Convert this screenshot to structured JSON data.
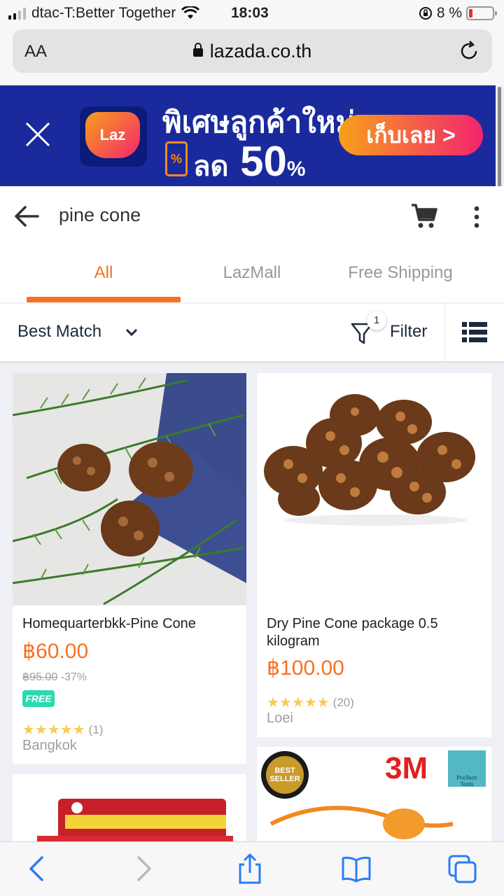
{
  "status": {
    "carrier": "dtac-T:Better Together",
    "time": "18:03",
    "battery": "8 %"
  },
  "browser": {
    "text_size": "AA",
    "domain": "lazada.co.th"
  },
  "banner": {
    "logo": "Laz",
    "headline": "พิเศษลูกค้าใหม่",
    "discount_prefix": "ลด",
    "discount_value": "50",
    "discount_unit": "%",
    "coupon_symbol": "%",
    "cta": "เก็บเลย >"
  },
  "search": {
    "query": "pine cone"
  },
  "tabs": [
    {
      "label": "All",
      "active": true
    },
    {
      "label": "LazMall",
      "active": false
    },
    {
      "label": "Free Shipping",
      "active": false
    }
  ],
  "sort": {
    "label": "Best Match",
    "filter_label": "Filter",
    "filter_count": "1"
  },
  "products": [
    {
      "title": "Homequarterbkk-Pine Cone",
      "price": "฿60.00",
      "original_price": "฿95.00",
      "discount": "-37%",
      "free_badge": "FREE",
      "rating": 5,
      "reviews": "(1)",
      "location": "Bangkok"
    },
    {
      "title": "Dry Pine Cone package 0.5 kilogram",
      "price": "฿100.00",
      "rating": 5,
      "reviews": "(20)",
      "location": "Loei"
    },
    {
      "title": ""
    },
    {
      "brand_logo": "3M",
      "seller_badge": "BEST SELLER",
      "store_logo": "ProTech Tools"
    }
  ],
  "colors": {
    "accent": "#f57224",
    "banner_bg": "#1a2a9c",
    "free_badge": "#2bd9b1",
    "star": "#faca51"
  }
}
